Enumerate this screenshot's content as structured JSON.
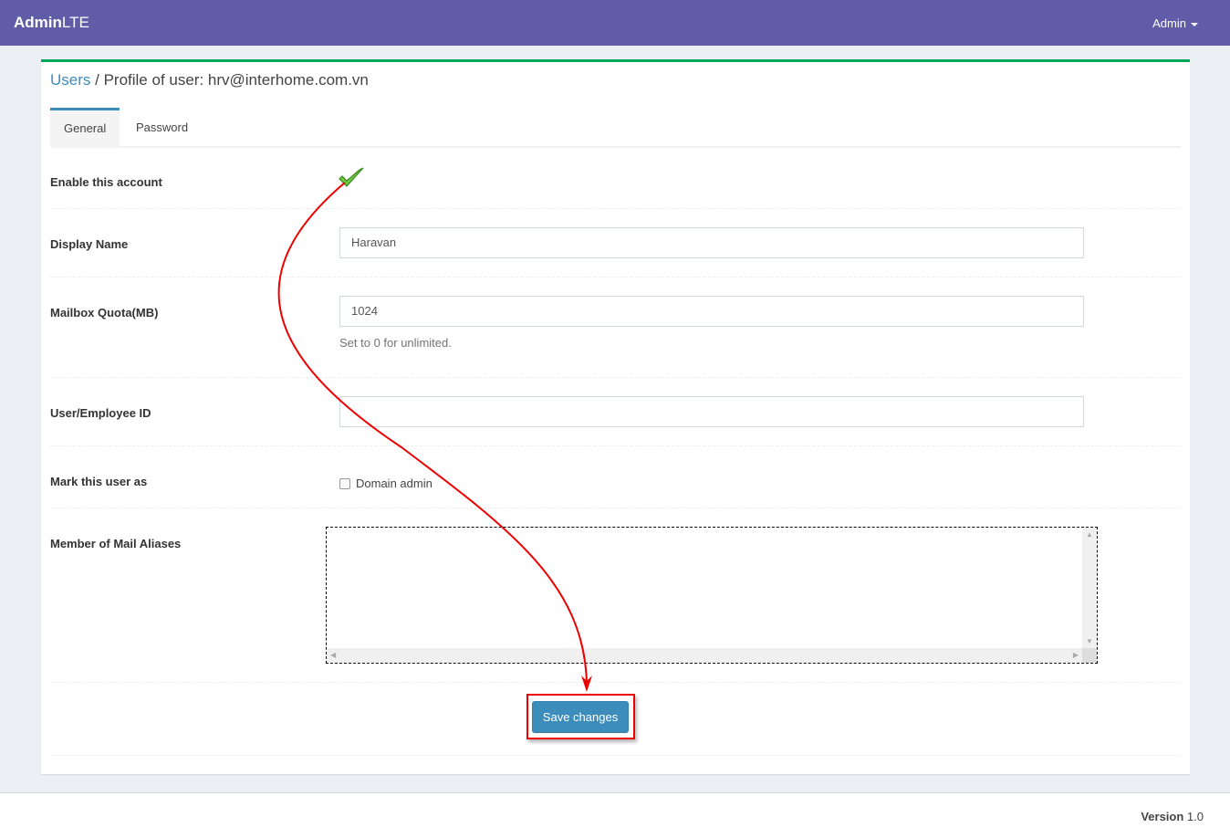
{
  "header": {
    "logo_bold": "Admin",
    "logo_light": "LTE",
    "user_menu": "Admin"
  },
  "breadcrumb": {
    "link": "Users",
    "separator": " / ",
    "title": "Profile of user: hrv@interhome.com.vn"
  },
  "tabs": [
    {
      "label": "General",
      "active": true
    },
    {
      "label": "Password",
      "active": false
    }
  ],
  "form": {
    "enable_label": "Enable this account",
    "display_name_label": "Display Name",
    "display_name_value": "Haravan",
    "quota_label": "Mailbox Quota(MB)",
    "quota_value": "1024",
    "quota_help": "Set to 0 for unlimited.",
    "employee_id_label": "User/Employee ID",
    "employee_id_value": "",
    "mark_label": "Mark this user as",
    "domain_admin_label": "Domain admin",
    "aliases_label": "Member of Mail Aliases",
    "save_label": "Save changes"
  },
  "footer": {
    "version_label": "Version",
    "version_value": "1.0"
  },
  "colors": {
    "header": "#605ca8",
    "accent": "#3c8dbc",
    "box_top": "#00a65a",
    "annotation": "#ff0000"
  }
}
